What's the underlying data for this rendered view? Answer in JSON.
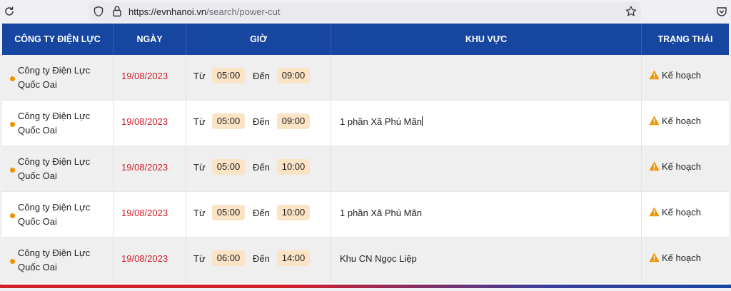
{
  "browser": {
    "url_domain": "https://evnhanoi.vn",
    "url_path": "/search/power-cut"
  },
  "table": {
    "headers": [
      "CÔNG TY ĐIỆN LỰC",
      "NGÀY",
      "GIỜ",
      "KHU VỰC",
      "TRẠNG THÁI"
    ],
    "from_label": "Từ",
    "to_label": "Đến",
    "rows": [
      {
        "company": "Công ty Điện Lực Quốc Oai",
        "date": "19/08/2023",
        "from": "05:00",
        "to": "09:00",
        "area": "",
        "status": "Kế hoạch"
      },
      {
        "company": "Công ty Điện Lực Quốc Oai",
        "date": "19/08/2023",
        "from": "05:00",
        "to": "09:00",
        "area": "1 phần Xã Phú Mãn",
        "status": "Kế hoạch"
      },
      {
        "company": "Công ty Điện Lực Quốc Oai",
        "date": "19/08/2023",
        "from": "05:00",
        "to": "10:00",
        "area": "",
        "status": "Kế hoạch"
      },
      {
        "company": "Công ty Điện Lực Quốc Oai",
        "date": "19/08/2023",
        "from": "05:00",
        "to": "10:00",
        "area": "1 phần Xã Phú Mãn",
        "status": "Kế hoạch"
      },
      {
        "company": "Công ty Điện Lực Quốc Oai",
        "date": "19/08/2023",
        "from": "06:00",
        "to": "14:00",
        "area": "Khu CN Ngọc Liệp",
        "status": "Kế hoạch"
      }
    ]
  },
  "colors": {
    "header_bg": "#1646a0",
    "date_red": "#d0202a",
    "dot_orange": "#f39200",
    "time_badge": "#fbe3c6",
    "warning": "#f39200"
  },
  "icons": [
    "reload-icon",
    "shield-icon",
    "lock-icon",
    "star-icon",
    "pocket-icon",
    "warning-icon"
  ]
}
